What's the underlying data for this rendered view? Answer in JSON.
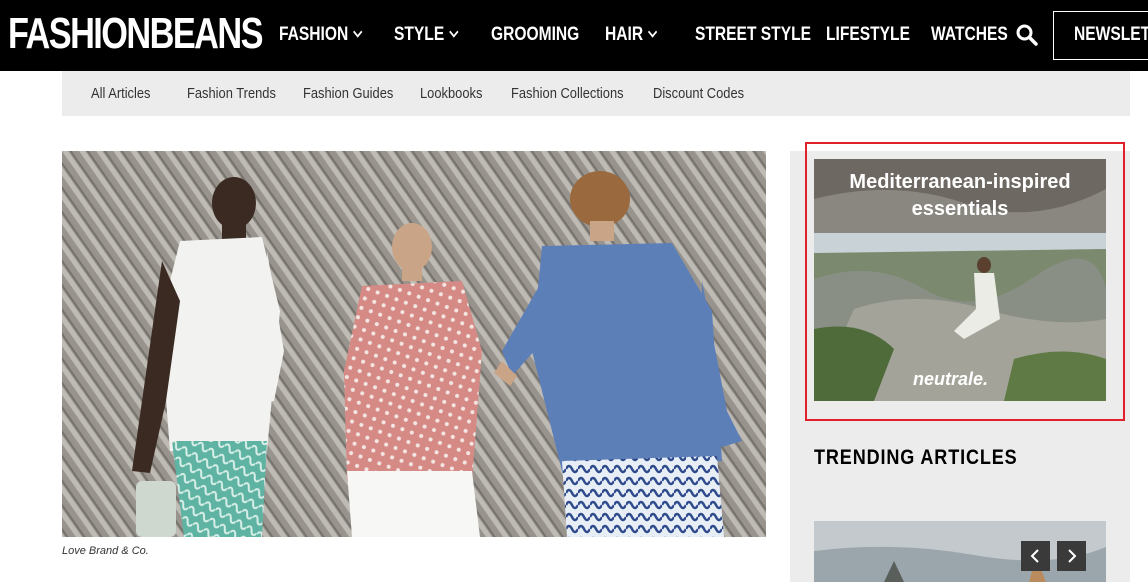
{
  "brand": {
    "logo_text": "FASHIONBEANS"
  },
  "nav": {
    "items": [
      {
        "label": "FASHION",
        "dropdown": true
      },
      {
        "label": "STYLE",
        "dropdown": true
      },
      {
        "label": "GROOMING",
        "dropdown": false
      },
      {
        "label": "HAIR",
        "dropdown": true
      },
      {
        "label": "STREET STYLE",
        "dropdown": false
      },
      {
        "label": "LIFESTYLE",
        "dropdown": false
      },
      {
        "label": "WATCHES",
        "dropdown": false
      }
    ],
    "search_icon": "search-icon",
    "newsletter_label": "NEWSLETTER"
  },
  "subnav": {
    "items": [
      "All Articles",
      "Fashion Trends",
      "Fashion Guides",
      "Lookbooks",
      "Fashion Collections",
      "Discount Codes"
    ]
  },
  "hero": {
    "caption": "Love Brand & Co."
  },
  "sidebar": {
    "ad": {
      "headline": "Mediterranean-inspired essentials",
      "brand": "neutrale."
    },
    "trending_title": "TRENDING ARTICLES",
    "carousel": {
      "prev_icon": "chevron-left-icon",
      "next_icon": "chevron-right-icon"
    }
  },
  "colors": {
    "topbar": "#000000",
    "subnav_bg": "#ececec",
    "sidebar_bg": "#ececec",
    "highlight_border": "#e0202a"
  }
}
